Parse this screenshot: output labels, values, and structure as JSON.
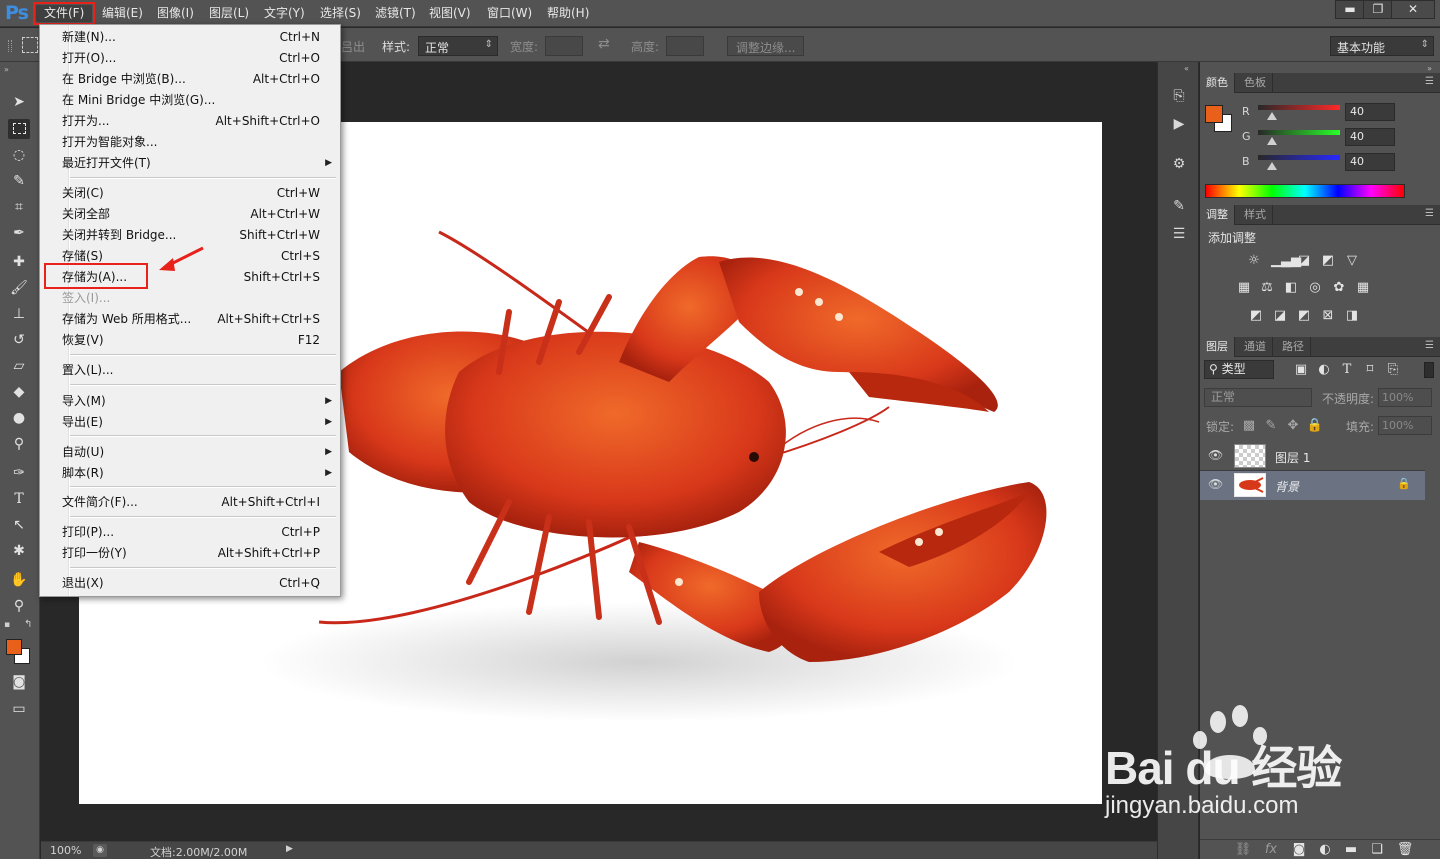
{
  "app": {
    "logo_text": "Ps"
  },
  "menubar": {
    "items": [
      "文件(F)",
      "编辑(E)",
      "图像(I)",
      "图层(L)",
      "文字(Y)",
      "选择(S)",
      "滤镜(T)",
      "视图(V)",
      "窗口(W)",
      "帮助(H)"
    ]
  },
  "window_controls": {
    "minimize": "▬",
    "restore": "❐",
    "close": "✕"
  },
  "options_bar": {
    "clipped_text": "吕出",
    "style_label": "样式:",
    "style_value": "正常",
    "width_label": "宽度:",
    "swap_icon": "⇄",
    "height_label": "高度:",
    "refine_edge_button": "调整边缘...",
    "workspace_value": "基本功能"
  },
  "file_menu": {
    "items": [
      {
        "label": "新建(N)...",
        "shortcut": "Ctrl+N"
      },
      {
        "label": "打开(O)...",
        "shortcut": "Ctrl+O"
      },
      {
        "label": "在 Bridge 中浏览(B)...",
        "shortcut": "Alt+Ctrl+O"
      },
      {
        "label": "在 Mini Bridge 中浏览(G)...",
        "shortcut": ""
      },
      {
        "label": "打开为...",
        "shortcut": "Alt+Shift+Ctrl+O"
      },
      {
        "label": "打开为智能对象...",
        "shortcut": ""
      },
      {
        "label": "最近打开文件(T)",
        "shortcut": ""
      },
      {
        "label": "关闭(C)",
        "shortcut": "Ctrl+W"
      },
      {
        "label": "关闭全部",
        "shortcut": "Alt+Ctrl+W"
      },
      {
        "label": "关闭并转到 Bridge...",
        "shortcut": "Shift+Ctrl+W"
      },
      {
        "label": "存储(S)",
        "shortcut": "Ctrl+S"
      },
      {
        "label": "存储为(A)...",
        "shortcut": "Shift+Ctrl+S"
      },
      {
        "label": "签入(I)...",
        "shortcut": ""
      },
      {
        "label": "存储为 Web 所用格式...",
        "shortcut": "Alt+Shift+Ctrl+S"
      },
      {
        "label": "恢复(V)",
        "shortcut": "F12"
      },
      {
        "label": "置入(L)...",
        "shortcut": ""
      },
      {
        "label": "导入(M)",
        "shortcut": ""
      },
      {
        "label": "导出(E)",
        "shortcut": ""
      },
      {
        "label": "自动(U)",
        "shortcut": ""
      },
      {
        "label": "脚本(R)",
        "shortcut": ""
      },
      {
        "label": "文件简介(F)...",
        "shortcut": "Alt+Shift+Ctrl+I"
      },
      {
        "label": "打印(P)...",
        "shortcut": "Ctrl+P"
      },
      {
        "label": "打印一份(Y)",
        "shortcut": "Alt+Shift+Ctrl+P"
      },
      {
        "label": "退出(X)",
        "shortcut": "Ctrl+Q"
      }
    ],
    "submenu_arrow": "▶",
    "highlighted_item": "存储为(A)..."
  },
  "color_panel": {
    "tabs": [
      "颜色",
      "色板"
    ],
    "channels": [
      {
        "label": "R",
        "value": "40"
      },
      {
        "label": "G",
        "value": "40"
      },
      {
        "label": "B",
        "value": "40"
      }
    ],
    "foreground_color": "#e8601a",
    "background_color": "#ffffff"
  },
  "adjustments_panel": {
    "tabs": [
      "调整",
      "样式"
    ],
    "title": "添加调整"
  },
  "layers_panel": {
    "tabs": [
      "图层",
      "通道",
      "路径"
    ],
    "filter_label": "类型",
    "blend_mode": "正常",
    "opacity_label": "不透明度:",
    "opacity_value": "100%",
    "lock_label": "锁定:",
    "fill_label": "填充:",
    "fill_value": "100%",
    "layers": [
      {
        "name": "图层 1"
      },
      {
        "name": "背景"
      }
    ]
  },
  "status_bar": {
    "zoom": "100%",
    "doc_info": "文档:2.00M/2.00M"
  },
  "watermark": {
    "brand": "Bai du 经验",
    "url": "jingyan.baidu.com"
  },
  "theme": {
    "accent_red": "#e8211a",
    "lobster_red": "#d8381a"
  }
}
